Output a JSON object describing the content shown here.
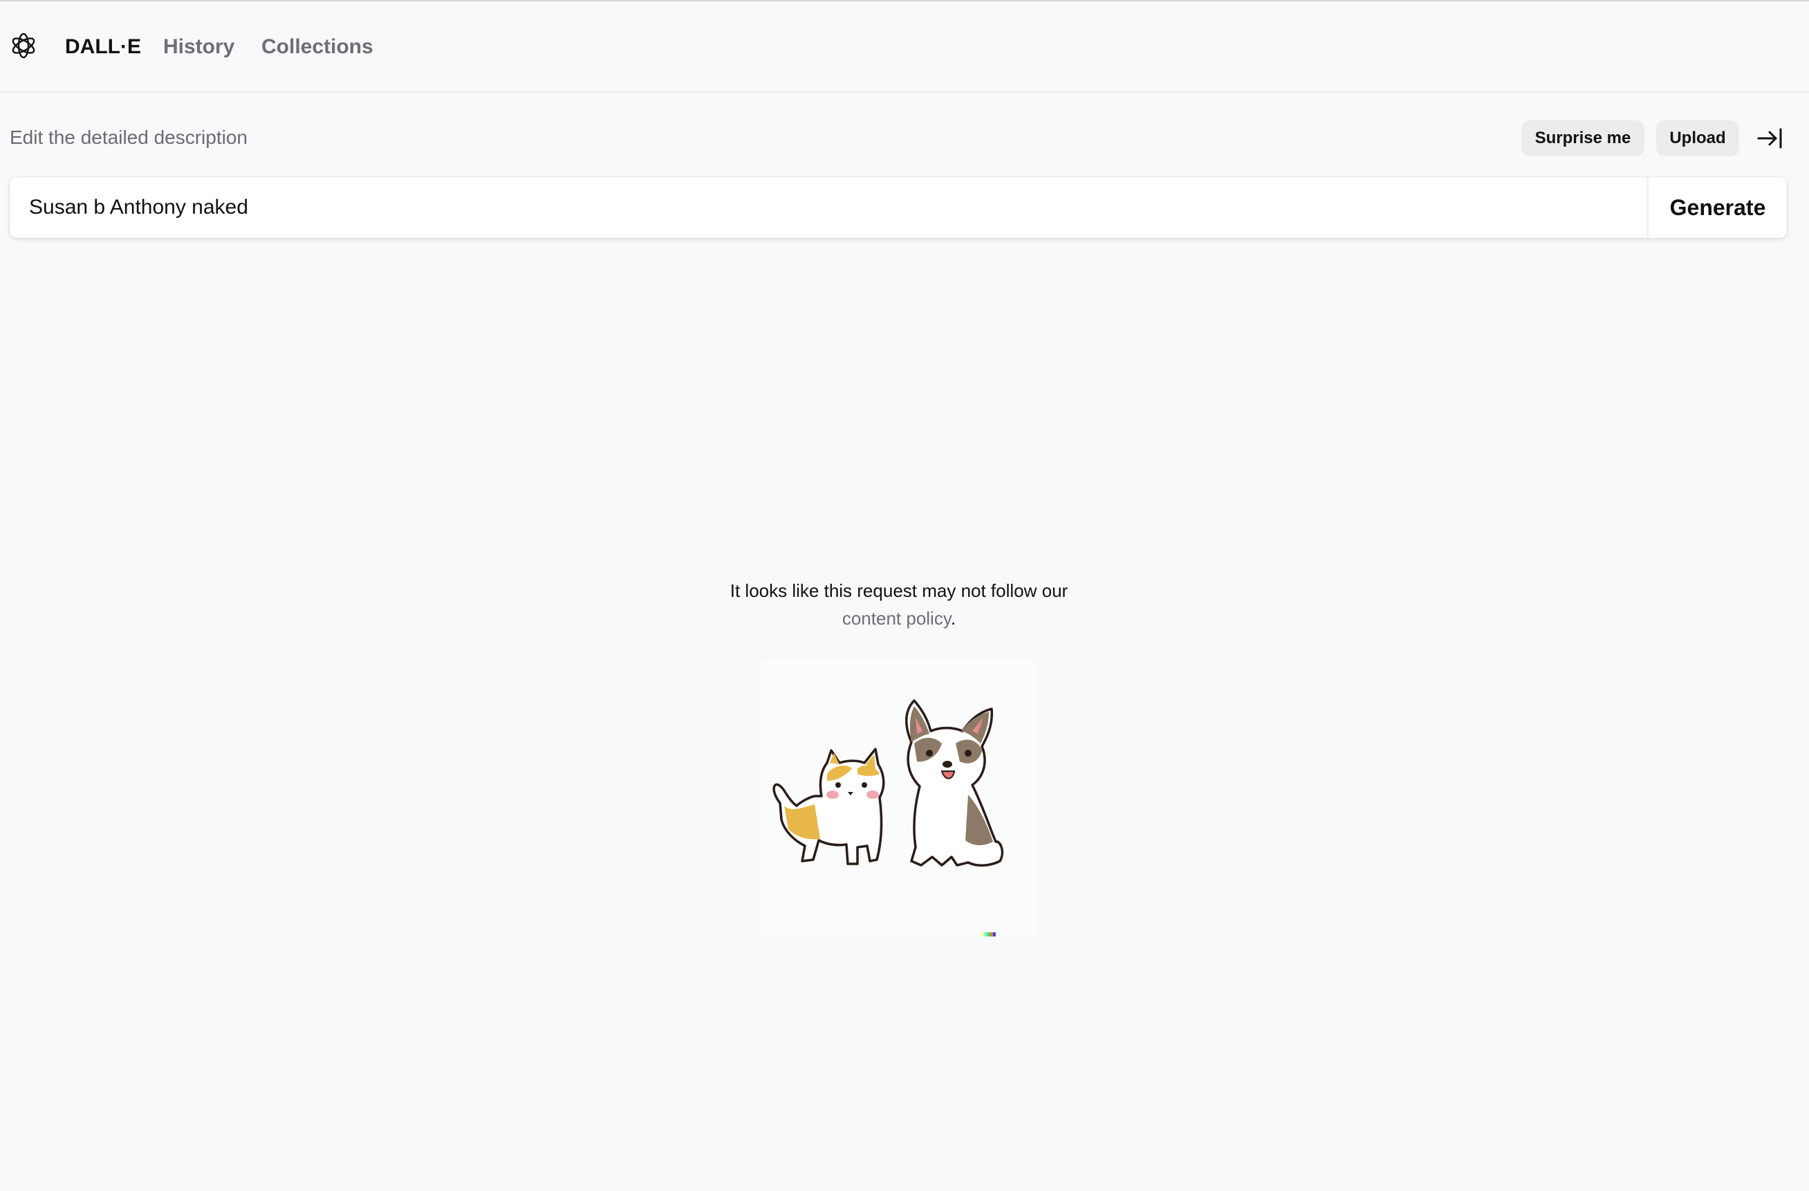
{
  "nav": {
    "brand": "DALL·E",
    "links": [
      "History",
      "Collections"
    ]
  },
  "prompt": {
    "label": "Edit the detailed description",
    "value": "Susan b Anthony naked",
    "surprise_label": "Surprise me",
    "upload_label": "Upload",
    "generate_label": "Generate"
  },
  "notice": {
    "message": "It looks like this request may not follow our",
    "link_text": "content policy",
    "suffix": "."
  },
  "icons": {
    "logo": "openai-logo-icon",
    "collapse": "collapse-arrow-icon",
    "illustration": "cat-and-corgi-illustration"
  },
  "colors": {
    "background": "#f9f9fb",
    "pill_background": "#ececef",
    "muted_text": "#6e6e73"
  }
}
